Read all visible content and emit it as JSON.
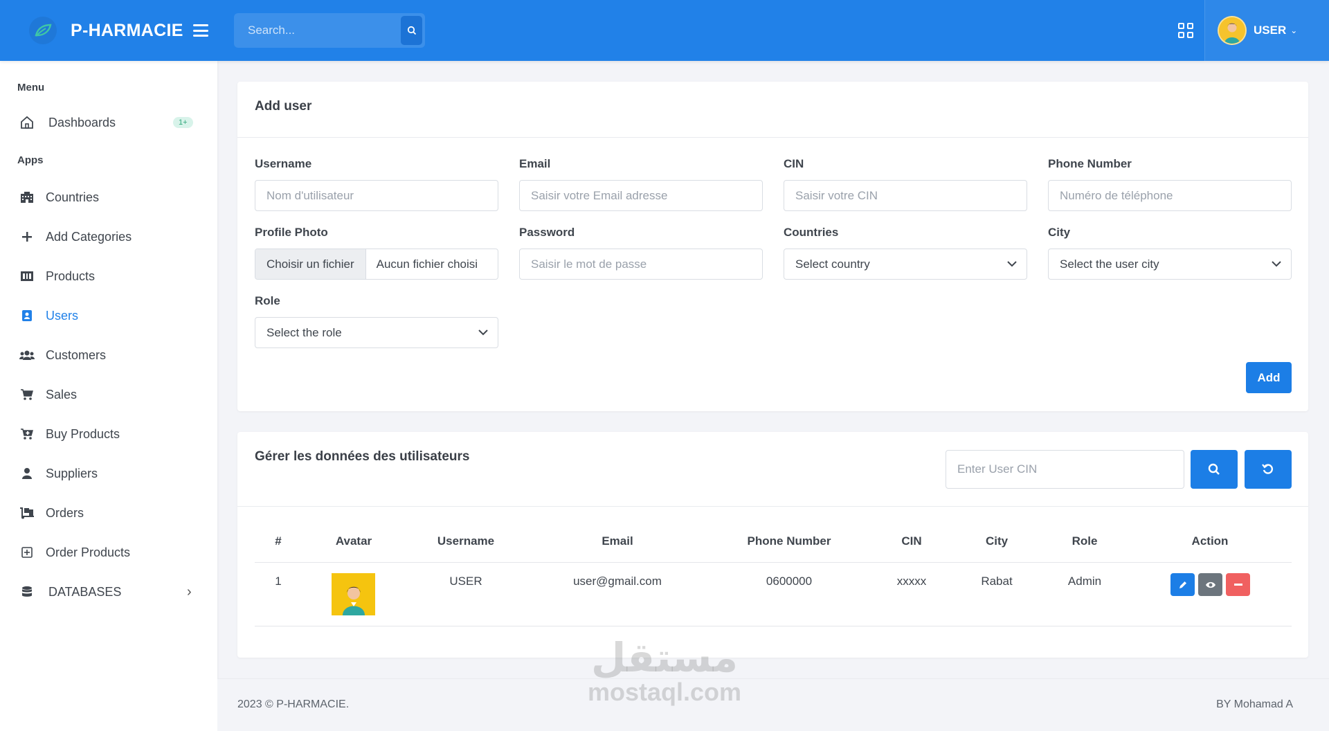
{
  "brand": {
    "name": "P-HARMACIE"
  },
  "header": {
    "search_placeholder": "Search...",
    "user_name": "USER"
  },
  "sidebar": {
    "menu_title": "Menu",
    "apps_title": "Apps",
    "dashboards": {
      "label": "Dashboards",
      "badge": "1+"
    },
    "items": [
      {
        "label": "Countries",
        "icon": "building-icon"
      },
      {
        "label": "Add Categories",
        "icon": "plus-icon"
      },
      {
        "label": "Products",
        "icon": "products-icon"
      },
      {
        "label": "Users",
        "icon": "id-badge-icon",
        "active": true
      },
      {
        "label": "Customers",
        "icon": "users-icon"
      },
      {
        "label": "Sales",
        "icon": "cart-icon"
      },
      {
        "label": "Buy Products",
        "icon": "cart-plus-icon"
      },
      {
        "label": "Suppliers",
        "icon": "user-icon"
      },
      {
        "label": "Orders",
        "icon": "dolly-icon"
      },
      {
        "label": "Order Products",
        "icon": "plus-square-icon"
      }
    ],
    "databases": {
      "label": "DATABASES"
    }
  },
  "add_user": {
    "title": "Add user",
    "username": {
      "label": "Username",
      "placeholder": "Nom d'utilisateur"
    },
    "email": {
      "label": "Email",
      "placeholder": "Saisir votre Email adresse"
    },
    "cin": {
      "label": "CIN",
      "placeholder": "Saisir votre CIN"
    },
    "phone": {
      "label": "Phone Number",
      "placeholder": "Numéro de téléphone"
    },
    "photo": {
      "label": "Profile Photo",
      "button": "Choisir un fichier",
      "file_name": "Aucun fichier choisi"
    },
    "password": {
      "label": "Password",
      "placeholder": "Saisir le mot de passe"
    },
    "countries": {
      "label": "Countries",
      "selected": "Select country"
    },
    "city": {
      "label": "City",
      "selected": "Select the user city"
    },
    "role": {
      "label": "Role",
      "selected": "Select the role"
    },
    "add_button": "Add"
  },
  "manage": {
    "title": "Gérer les données des utilisateurs",
    "cin_placeholder": "Enter User CIN",
    "columns": [
      "#",
      "Avatar",
      "Username",
      "Email",
      "Phone Number",
      "CIN",
      "City",
      "Role",
      "Action"
    ],
    "rows": [
      {
        "index": "1",
        "username": "USER",
        "email": "user@gmail.com",
        "phone": "0600000",
        "cin": "xxxxx",
        "city": "Rabat",
        "role": "Admin"
      }
    ]
  },
  "footer": {
    "left": "2023 © P-HARMACIE.",
    "right": "BY Mohamad A"
  },
  "watermark": {
    "arabic": "مستقل",
    "latin": "mostaql.com"
  },
  "colors": {
    "primary": "#2181e8",
    "button_blue": "#1c7ee6",
    "edit": "#1c7ee6",
    "view": "#6c757d",
    "delete": "#f06060",
    "avatar_bg": "#f5c40f"
  }
}
